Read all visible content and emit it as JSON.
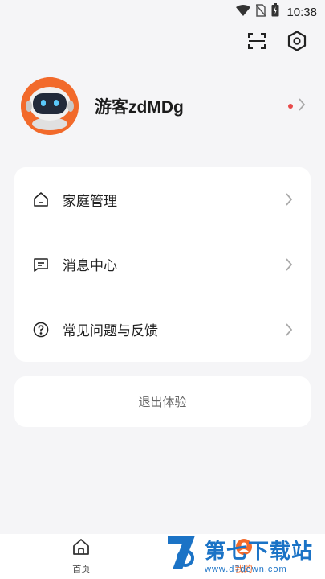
{
  "status_bar": {
    "time": "10:38"
  },
  "profile": {
    "username": "游客zdMDg"
  },
  "menu": {
    "items": [
      {
        "label": "家庭管理",
        "icon": "home-icon"
      },
      {
        "label": "消息中心",
        "icon": "message-icon"
      },
      {
        "label": "常见问题与反馈",
        "icon": "help-icon"
      }
    ]
  },
  "logout": {
    "label": "退出体验"
  },
  "bottom_nav": {
    "items": [
      {
        "label": "首页",
        "icon": "home-icon"
      },
      {
        "label": "我的",
        "icon": "user-icon"
      }
    ]
  },
  "watermark": {
    "text": "第七下载站",
    "url": "www.d7down.com"
  },
  "colors": {
    "accent": "#f26a2b",
    "background": "#f5f5f7",
    "dot": "#e84a4a",
    "watermark": "#1b73c6"
  }
}
